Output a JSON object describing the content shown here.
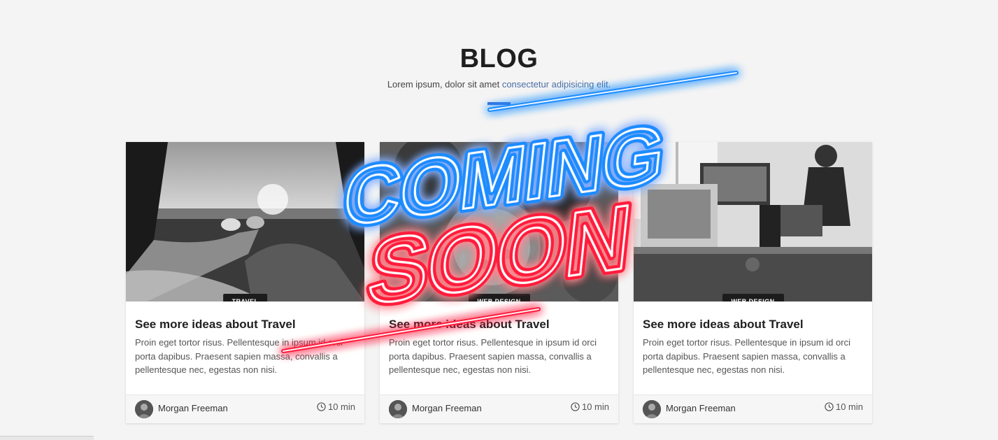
{
  "header": {
    "title": "BLOG",
    "subtitle_plain": "Lorem ipsum, dolor sit amet ",
    "subtitle_link": "consectetur adipisicing elit."
  },
  "overlay": {
    "line1": "COMING",
    "line2": "SOON",
    "line1_color": "#1a8cff",
    "line2_color": "#ff1a3c"
  },
  "colors": {
    "accent": "#3d6fd9",
    "badge_bg": "#1c1c1c"
  },
  "cards": [
    {
      "badge": "TRAVEL",
      "title": "See more ideas about Travel",
      "text": "Proin eget tortor risus. Pellentesque in ipsum id orci porta dapibus. Praesent sapien massa, convallis a pellentesque nec, egestas non nisi.",
      "author": "Morgan Freeman",
      "time": "10 min",
      "image_icon": "travel-photo"
    },
    {
      "badge": "WEB DESIGN",
      "title": "See more ideas about Travel",
      "text": "Proin eget tortor risus. Pellentesque in ipsum id orci porta dapibus. Praesent sapien massa, convallis a pellentesque nec, egestas non nisi.",
      "author": "Morgan Freeman",
      "time": "10 min",
      "image_icon": "food-photo"
    },
    {
      "badge": "WEB DESIGN",
      "title": "See more ideas about Travel",
      "text": "Proin eget tortor risus. Pellentesque in ipsum id orci porta dapibus. Praesent sapien massa, convallis a pellentesque nec, egestas non nisi.",
      "author": "Morgan Freeman",
      "time": "10 min",
      "image_icon": "office-photo"
    }
  ]
}
